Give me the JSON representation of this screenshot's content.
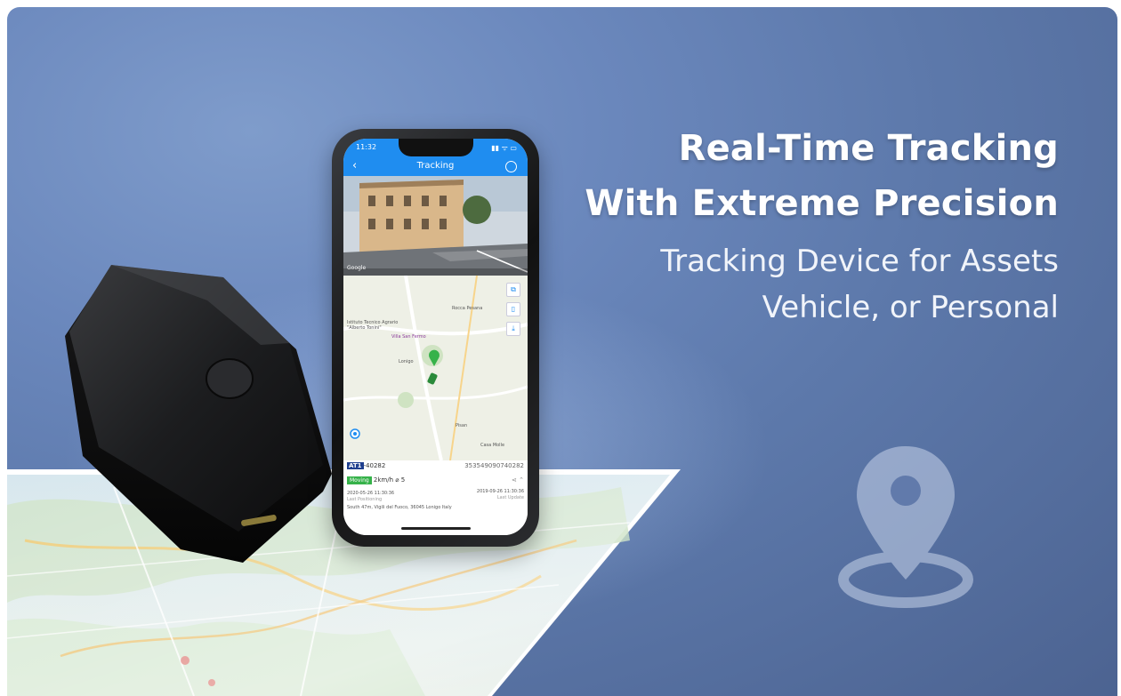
{
  "headline": {
    "line1": "Real-Time Tracking",
    "line2": "With Extreme Precision",
    "sub1": "Tracking Device for Assets",
    "sub2": "Vehicle, or Personal"
  },
  "phone": {
    "status_time": "11:32",
    "status_icons": "▮▮ ᯤ ▭",
    "nav_title": "Tracking",
    "back_glyph": "‹",
    "street_credit": "Google",
    "map_labels": {
      "rocca": "Rocca Pesana",
      "istituto": "Istituto Tecnico Agrario \"Alberto Tonini\"",
      "villa": "Villa San Fermo",
      "lonigo": "Lonigo",
      "pisan": "Pisan",
      "casa": "Casa Molle"
    },
    "map_buttons": [
      "⧉",
      "▯",
      "⤓"
    ],
    "device_id_prefix": "AT1",
    "device_id": "-40282",
    "imei": "353549090740282",
    "status_moving": "Moving",
    "speed": "2km/h",
    "satellites": "⌀ 5",
    "last_position_time": "2020-05-26 11:30:36",
    "last_position_label": "Last Positioning",
    "last_update_time": "2019-09-26 11:30:36",
    "last_update_label": "Last Update",
    "address": "South 47m, Vigili del Fuoco, 36045 Lonigo Italy"
  },
  "colors": {
    "app_blue": "#1f8df0",
    "bg_blue": "#6b88bd",
    "moving_green": "#36b24a"
  }
}
